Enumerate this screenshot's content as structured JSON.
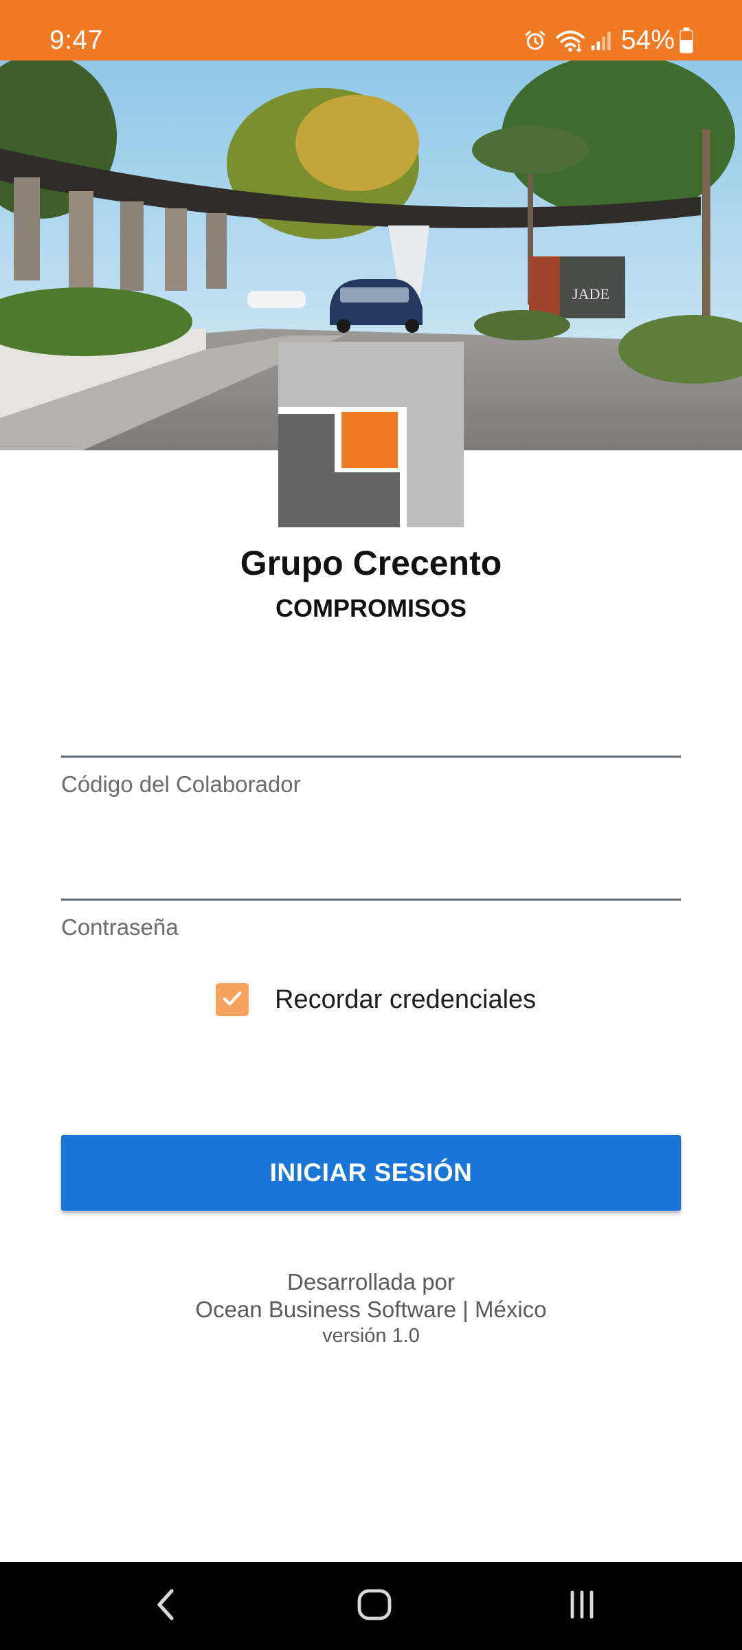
{
  "status_bar": {
    "time": "9:47",
    "battery_percent": "54%",
    "background_color": "#F07A23",
    "icons": [
      "alarm-icon",
      "wifi-icon",
      "cell-signal-icon",
      "battery-icon"
    ]
  },
  "hero": {
    "sign_text": "JADE"
  },
  "brand": {
    "name": "Grupo Crecento",
    "subtitle": "COMPROMISOS",
    "logo_colors": {
      "light_gray": "#BDBDBD",
      "dark_gray": "#646464",
      "orange": "#F07A23"
    }
  },
  "form": {
    "employee_code": {
      "value": "",
      "label": "Código del Colaborador"
    },
    "password": {
      "value": "",
      "label": "Contraseña"
    },
    "remember": {
      "label": "Recordar credenciales",
      "checked": true,
      "color": "#F5A35D"
    },
    "submit_label": "INICIAR SESIÓN",
    "submit_color": "#1976D8"
  },
  "footer": {
    "developed_by": "Desarrollada por",
    "company": "Ocean Business Software | México",
    "version": "versión 1.0"
  },
  "nav_bar": {
    "icons": [
      "back-icon",
      "home-icon",
      "recent-apps-icon"
    ]
  }
}
